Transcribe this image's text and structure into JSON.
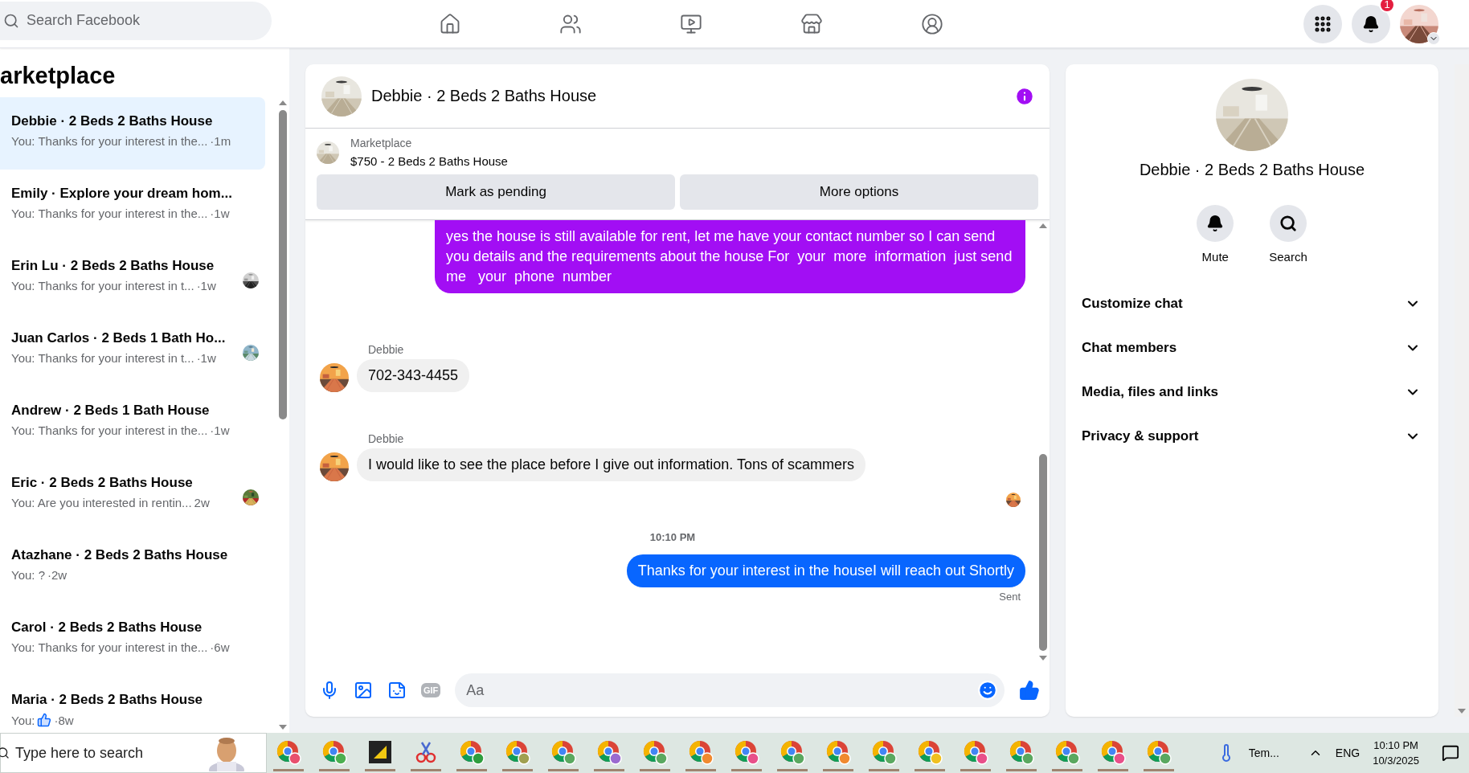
{
  "top_bar": {
    "search": {
      "placeholder": "Search Facebook"
    },
    "notification_count": "1"
  },
  "sidebar": {
    "title": "arketplace",
    "conversations": [
      {
        "name": "Debbie · 2 Beds 2 Baths House",
        "kind": "text",
        "preview": "You: Thanks for your interest in the...",
        "time": "·1m",
        "selected": true,
        "seen": false
      },
      {
        "name": "Emily · Explore your dream hom...",
        "kind": "text",
        "preview": "You: Thanks for your interest in the...",
        "time": "·1w",
        "selected": false,
        "seen": false
      },
      {
        "name": "Erin Lu · 2 Beds 2 Baths House",
        "kind": "text",
        "preview": "You: Thanks for your interest in t...",
        "time": "·1w",
        "selected": false,
        "seen": true
      },
      {
        "name": "Juan Carlos · 2 Beds 1 Bath Ho...",
        "kind": "text",
        "preview": "You: Thanks for your interest in t...",
        "time": "·1w",
        "selected": false,
        "seen": true
      },
      {
        "name": "Andrew · 2 Beds 1 Bath House",
        "kind": "text",
        "preview": "You: Thanks for your interest in the...",
        "time": "·1w",
        "selected": false,
        "seen": false
      },
      {
        "name": "Eric · 2 Beds 2 Baths House",
        "kind": "text",
        "preview": "You: Are you interested in rentin...",
        "time": "2w",
        "selected": false,
        "seen": true
      },
      {
        "name": "Atazhane · 2 Beds 2 Baths House",
        "kind": "text",
        "preview": "You: ?",
        "time": "·2w",
        "selected": false,
        "seen": false
      },
      {
        "name": "Carol · 2 Beds 2 Baths House",
        "kind": "text",
        "preview": "You: Thanks for your interest in the...",
        "time": "·6w",
        "selected": false,
        "seen": false
      },
      {
        "name": "Maria · 2 Beds 2 Baths House",
        "kind": "like",
        "preview": "You:",
        "time": "·8w",
        "selected": false,
        "seen": false
      }
    ]
  },
  "chat": {
    "title": "Debbie · 2 Beds 2 Baths House",
    "listing": {
      "label": "Marketplace",
      "title": "$750 - 2 Beds 2 Baths House",
      "buttons": [
        "Mark as pending",
        "More options"
      ]
    },
    "messages": [
      {
        "kind": "outgoing",
        "color": "#a20ef4",
        "text": "yes the house is still available for rent, let me have your contact number so I can send you details and the requirements about the house For  your  more  information  just send  me   your  phone  number"
      },
      {
        "kind": "incoming",
        "sender": "Debbie",
        "text": "702-343-4455"
      },
      {
        "kind": "incoming",
        "sender": "Debbie",
        "text": "I would like to see the place before I give out information. Tons of scammers"
      },
      {
        "kind": "seen"
      },
      {
        "kind": "time",
        "text": "10:10 PM"
      },
      {
        "kind": "outgoing",
        "color": "#0866ff",
        "text": "Thanks for your interest in the houseI will reach out Shortly",
        "status": "Sent"
      }
    ],
    "composer": {
      "placeholder": "Aa",
      "gif_label": "GIF"
    }
  },
  "details": {
    "title": "Debbie · 2 Beds 2 Baths House",
    "actions": [
      {
        "kind": "mute",
        "label": "Mute"
      },
      {
        "kind": "search",
        "label": "Search"
      }
    ],
    "sections": [
      {
        "label": "Customize chat",
        "expanded": false
      },
      {
        "label": "Chat members",
        "expanded": false
      },
      {
        "label": "Media, files and links",
        "expanded": false
      },
      {
        "label": "Privacy & support",
        "expanded": false
      }
    ]
  },
  "taskbar": {
    "search_placeholder": "Type here to search",
    "apps": [
      {
        "kind": "browser",
        "color": "#e8506e"
      },
      {
        "kind": "browser",
        "color": "#4caf50"
      },
      {
        "kind": "notes"
      },
      {
        "kind": "snip"
      },
      {
        "kind": "browser",
        "color": "#2e9e3e"
      },
      {
        "kind": "browser",
        "color": "#a0a050"
      },
      {
        "kind": "browser",
        "color": "#5aa860"
      },
      {
        "kind": "browser",
        "color": "#9a6ad0"
      },
      {
        "kind": "browser",
        "color": "#5aa860"
      },
      {
        "kind": "browser",
        "color": "#f08a30"
      },
      {
        "kind": "browser",
        "color": "#e8508a"
      },
      {
        "kind": "browser",
        "color": "#5aa860"
      },
      {
        "kind": "browser",
        "color": "#f08a30"
      },
      {
        "kind": "browser",
        "color": "#5aa860"
      },
      {
        "kind": "browser",
        "color": "#f0c020"
      },
      {
        "kind": "browser",
        "color": "#e8508a"
      },
      {
        "kind": "browser",
        "color": "#5aa860"
      },
      {
        "kind": "browser",
        "color": "#5aa860"
      },
      {
        "kind": "browser",
        "color": "#e8508a"
      },
      {
        "kind": "browser",
        "color": "#5aa860"
      }
    ],
    "weather": "Tem...",
    "language": "ENG",
    "time": "10:10 PM",
    "date": "10/3/2025"
  }
}
